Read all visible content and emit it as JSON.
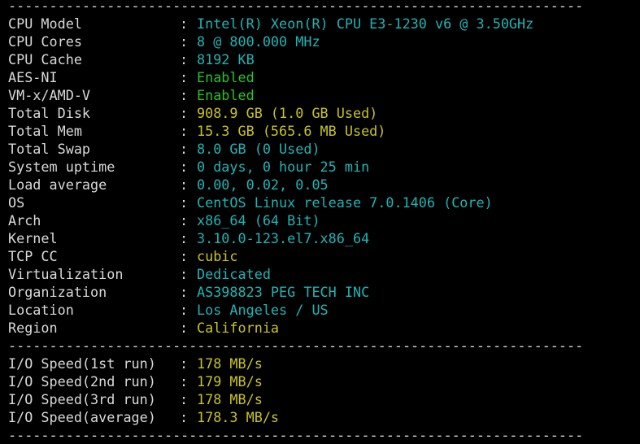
{
  "separator": "----------------------------------------------------------------------",
  "colors": {
    "background": "#000000",
    "label": "#d9d9d9",
    "cyan": "#1fb5b5",
    "green": "#26c426",
    "yellow": "#c9c41c"
  },
  "system": {
    "cpu_model": {
      "label": "CPU Model",
      "value": "Intel(R) Xeon(R) CPU E3-1230 v6 @ 3.50GHz"
    },
    "cpu_cores": {
      "label": "CPU Cores",
      "value": "8 @ 800.000 MHz"
    },
    "cpu_cache": {
      "label": "CPU Cache",
      "value": "8192 KB"
    },
    "aes_ni": {
      "label": "AES-NI",
      "value": "Enabled"
    },
    "vmx": {
      "label": "VM-x/AMD-V",
      "value": "Enabled"
    },
    "total_disk": {
      "label": "Total Disk",
      "value": "908.9 GB (1.0 GB Used)"
    },
    "total_mem": {
      "label": "Total Mem",
      "value": "15.3 GB (565.6 MB Used)"
    },
    "total_swap": {
      "label": "Total Swap",
      "value": "8.0 GB (0 Used)"
    },
    "uptime": {
      "label": "System uptime",
      "value": "0 days, 0 hour 25 min"
    },
    "load": {
      "label": "Load average",
      "value": "0.00, 0.02, 0.05"
    },
    "os": {
      "label": "OS",
      "value": "CentOS Linux release 7.0.1406 (Core)"
    },
    "arch": {
      "label": "Arch",
      "value": "x86_64 (64 Bit)"
    },
    "kernel": {
      "label": "Kernel",
      "value": "3.10.0-123.el7.x86_64"
    },
    "tcp_cc": {
      "label": "TCP CC",
      "value": "cubic"
    },
    "virt": {
      "label": "Virtualization",
      "value": "Dedicated"
    },
    "org": {
      "label": "Organization",
      "value": "AS398823 PEG TECH INC"
    },
    "location": {
      "label": "Location",
      "value": "Los Angeles / US"
    },
    "region": {
      "label": "Region",
      "value": "California"
    }
  },
  "io": {
    "run1": {
      "label": "I/O Speed(1st run)",
      "value": "178 MB/s"
    },
    "run2": {
      "label": "I/O Speed(2nd run)",
      "value": "179 MB/s"
    },
    "run3": {
      "label": "I/O Speed(3rd run)",
      "value": "178 MB/s"
    },
    "avg": {
      "label": "I/O Speed(average)",
      "value": "178.3 MB/s"
    }
  }
}
